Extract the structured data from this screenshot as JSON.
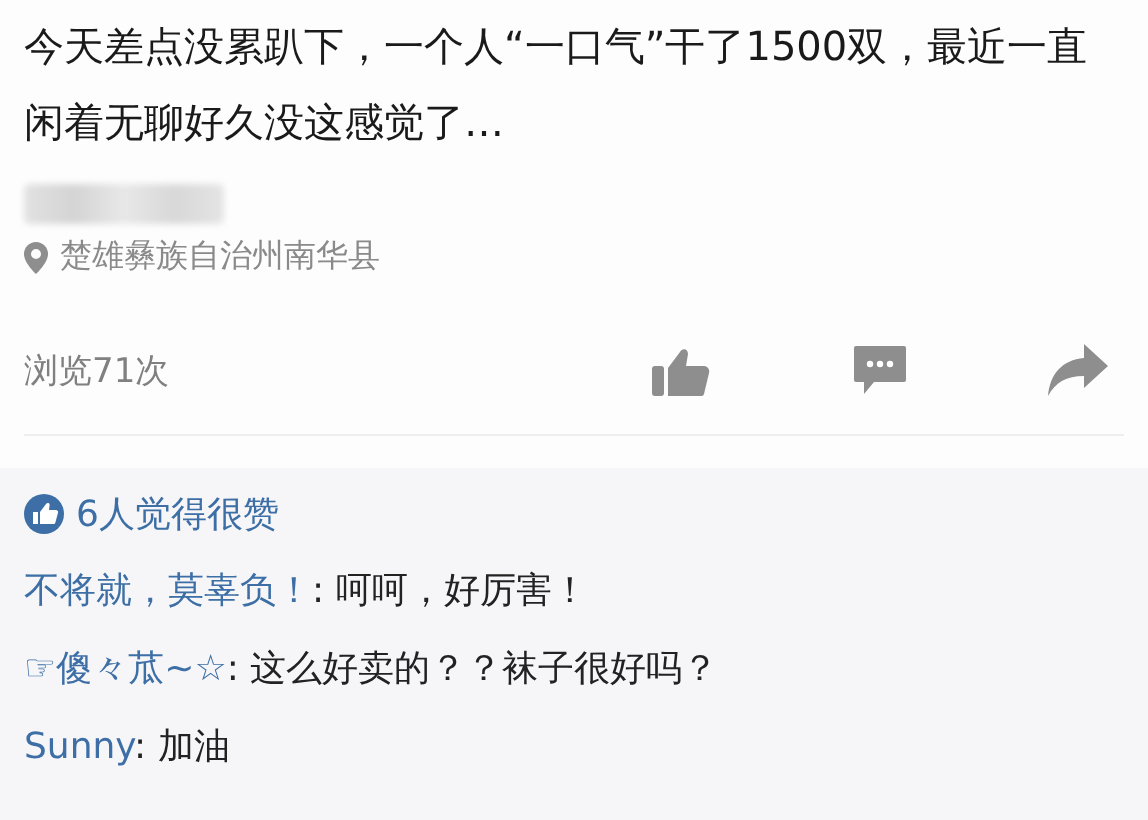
{
  "post": {
    "text": "今天差点没累趴下，一个人“一口气”干了1500双，最近一直闲着无聊好久没这感觉了…",
    "location": "楚雄彝族自治州南华县",
    "views": "浏览71次"
  },
  "likes": {
    "text": "6人觉得很赞"
  },
  "comments": [
    {
      "name": "不将就，莫辜负！",
      "text": ": 呵呵，好厉害！"
    },
    {
      "name": "☞傻々苽~☆",
      "text": ": 这么好卖的？？袜子很好吗？"
    },
    {
      "name": "Sunny",
      "text": ": 加油"
    }
  ]
}
